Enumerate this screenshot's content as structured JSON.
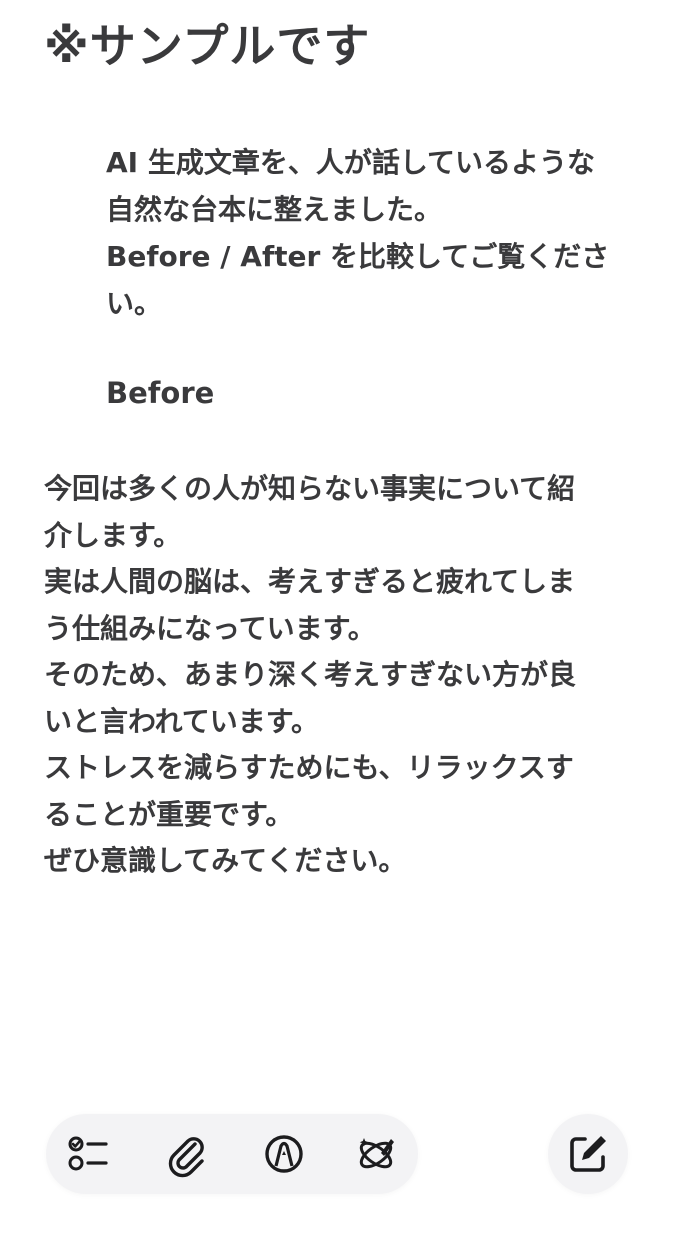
{
  "note": {
    "title": "※サンプルです",
    "intro_lines": [
      "AI 生成文章を、人が話しているような",
      "自然な台本に整えました。",
      "Before / After を比較してご覧くださ",
      "い。"
    ],
    "before_heading": "Before",
    "body_lines": [
      "今回は多くの人が知らない事実について紹",
      "介します。",
      "実は人間の脳は、考えすぎると疲れてしま",
      "う仕組みになっています。",
      "そのため、あまり深く考えすぎない方が良",
      "いと言われています。",
      "ストレスを減らすためにも、リラックスす",
      "ることが重要です。",
      "ぜひ意識してみてください。"
    ]
  },
  "toolbar": {
    "items": [
      {
        "icon": "checklist-icon"
      },
      {
        "icon": "paperclip-icon"
      },
      {
        "icon": "markup-pen-icon"
      },
      {
        "icon": "writing-tools-icon"
      }
    ],
    "compose_icon": "compose-icon"
  },
  "colors": {
    "text": "#3a3a3c",
    "background": "#ffffff",
    "toolbar_bg": "#f3f3f5",
    "icon": "#1c1c1e"
  }
}
